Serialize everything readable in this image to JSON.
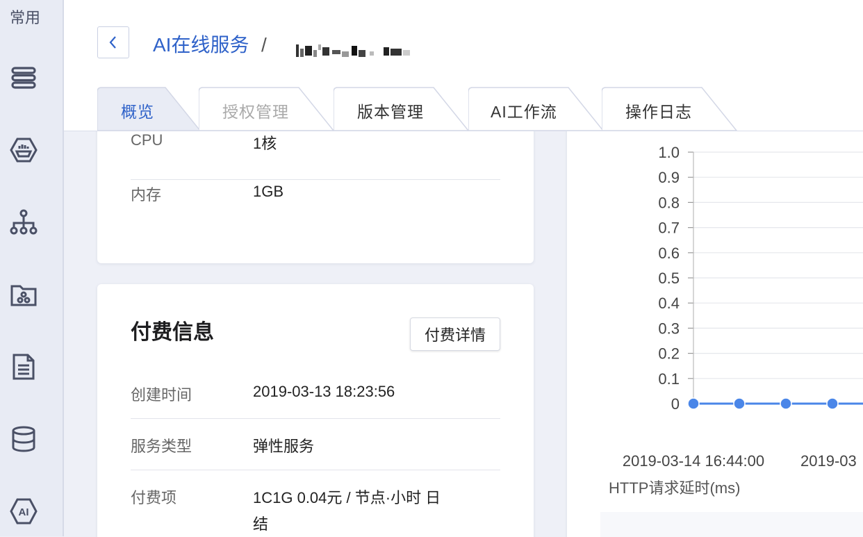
{
  "sidebar": {
    "title": "常用",
    "icons": [
      "menu-stack-icon",
      "cloud-engine-icon",
      "org-tree-icon",
      "folder-share-icon",
      "document-icon",
      "database-icon",
      "ai-icon"
    ]
  },
  "header": {
    "breadcrumb_link": "AI在线服务",
    "breadcrumb_sep": "/"
  },
  "tabs": [
    {
      "label": "概览",
      "state": "active"
    },
    {
      "label": "授权管理",
      "state": "disabled"
    },
    {
      "label": "版本管理",
      "state": "normal"
    },
    {
      "label": "AI工作流",
      "state": "normal"
    },
    {
      "label": "操作日志",
      "state": "normal"
    }
  ],
  "resources": {
    "rows": [
      {
        "key": "CPU",
        "value": "1核"
      },
      {
        "key": "内存",
        "value": "1GB"
      }
    ]
  },
  "billing": {
    "title": "付费信息",
    "detail_button": "付费详情",
    "rows": [
      {
        "key": "创建时间",
        "value": "2019-03-13 18:23:56"
      },
      {
        "key": "服务类型",
        "value": "弹性服务"
      },
      {
        "key": "付费项",
        "value_line1": "1C1G 0.04元 / 节点·小时 日",
        "value_line2": "结"
      }
    ]
  },
  "colors": {
    "accent": "#2f62c9",
    "series": "#4a86e8",
    "sidebar_bg": "#e8ebf4",
    "page_bg": "#eef0f7"
  },
  "chart_data": {
    "type": "line",
    "y_ticks": [
      "1.0",
      "0.9",
      "0.8",
      "0.7",
      "0.6",
      "0.5",
      "0.4",
      "0.3",
      "0.2",
      "0.1",
      "0"
    ],
    "ylim": [
      0,
      1.0
    ],
    "x_labels": [
      "2019-03-14 16:44:00",
      "2019-03"
    ],
    "series": [
      {
        "values": [
          0,
          0,
          0,
          0
        ]
      }
    ],
    "grid": true,
    "caption": "HTTP请求延时(ms)"
  }
}
